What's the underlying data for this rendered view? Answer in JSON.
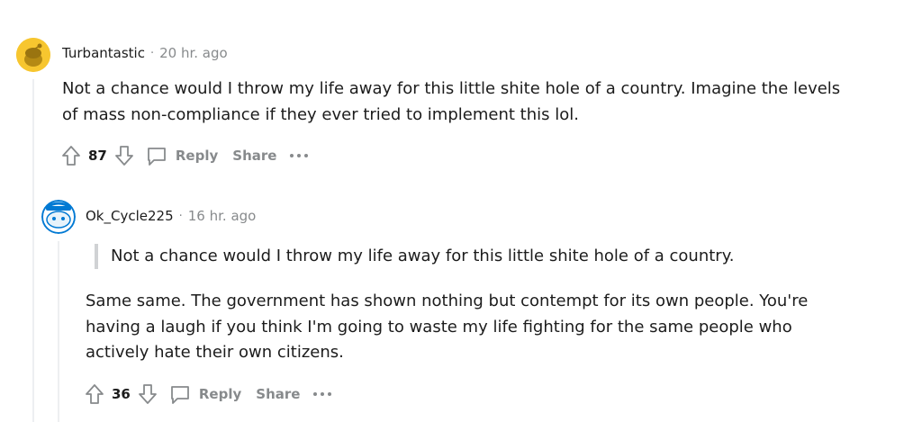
{
  "comments": [
    {
      "username": "Turbantastic",
      "separator": "·",
      "time": "20 hr. ago",
      "body_lines": [
        "Not a chance would I throw my life away for this little shite hole of a country. Imagine the levels",
        "of mass non-compliance if they ever tried to implement this lol."
      ],
      "votes": "87",
      "reply_label": "Reply",
      "share_label": "Share",
      "avatar_color": "#f5c518"
    },
    {
      "username": "Ok_Cycle225",
      "separator": "·",
      "time": "16 hr. ago",
      "quote": "Not a chance would I throw my life away for this little shite hole of a country.",
      "body_lines": [
        "Same same. The government has shown nothing but contempt for its own people. You're",
        "having a laugh if you think I'm going to waste my life fighting for the same people who",
        "actively hate their own citizens."
      ],
      "votes": "36",
      "reply_label": "Reply",
      "share_label": "Share",
      "avatar_color": "#0079d3"
    }
  ],
  "colors": {
    "meta_gray": "#878a8c",
    "thread_line": "#edeff1",
    "text": "#1c1c1c"
  }
}
